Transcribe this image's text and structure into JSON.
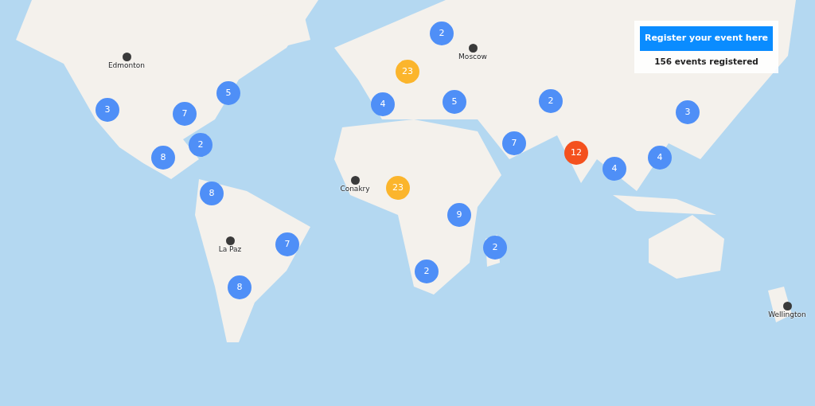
{
  "panel": {
    "register_button": "Register your event here",
    "count_text": "156 events registered"
  },
  "clusters": [
    {
      "count": "2",
      "color": "#4f8ff7"
    },
    {
      "count": "23",
      "color": "#fbb52c"
    },
    {
      "count": "5",
      "color": "#4f8ff7"
    },
    {
      "count": "3",
      "color": "#4f8ff7"
    },
    {
      "count": "7",
      "color": "#4f8ff7"
    },
    {
      "count": "4",
      "color": "#4f8ff7"
    },
    {
      "count": "5",
      "color": "#4f8ff7"
    },
    {
      "count": "2",
      "color": "#4f8ff7"
    },
    {
      "count": "3",
      "color": "#4f8ff7"
    },
    {
      "count": "2",
      "color": "#4f8ff7"
    },
    {
      "count": "8",
      "color": "#4f8ff7"
    },
    {
      "count": "7",
      "color": "#4f8ff7"
    },
    {
      "count": "12",
      "color": "#f4511e"
    },
    {
      "count": "4",
      "color": "#4f8ff7"
    },
    {
      "count": "4",
      "color": "#4f8ff7"
    },
    {
      "count": "23",
      "color": "#fbb52c"
    },
    {
      "count": "8",
      "color": "#4f8ff7"
    },
    {
      "count": "9",
      "color": "#4f8ff7"
    },
    {
      "count": "7",
      "color": "#4f8ff7"
    },
    {
      "count": "2",
      "color": "#4f8ff7"
    },
    {
      "count": "2",
      "color": "#4f8ff7"
    },
    {
      "count": "8",
      "color": "#4f8ff7"
    }
  ],
  "points": [
    {
      "label": "Edmonton"
    },
    {
      "label": "Moscow"
    },
    {
      "label": "Conakry"
    },
    {
      "label": "La Paz"
    },
    {
      "label": "Wellington"
    }
  ]
}
